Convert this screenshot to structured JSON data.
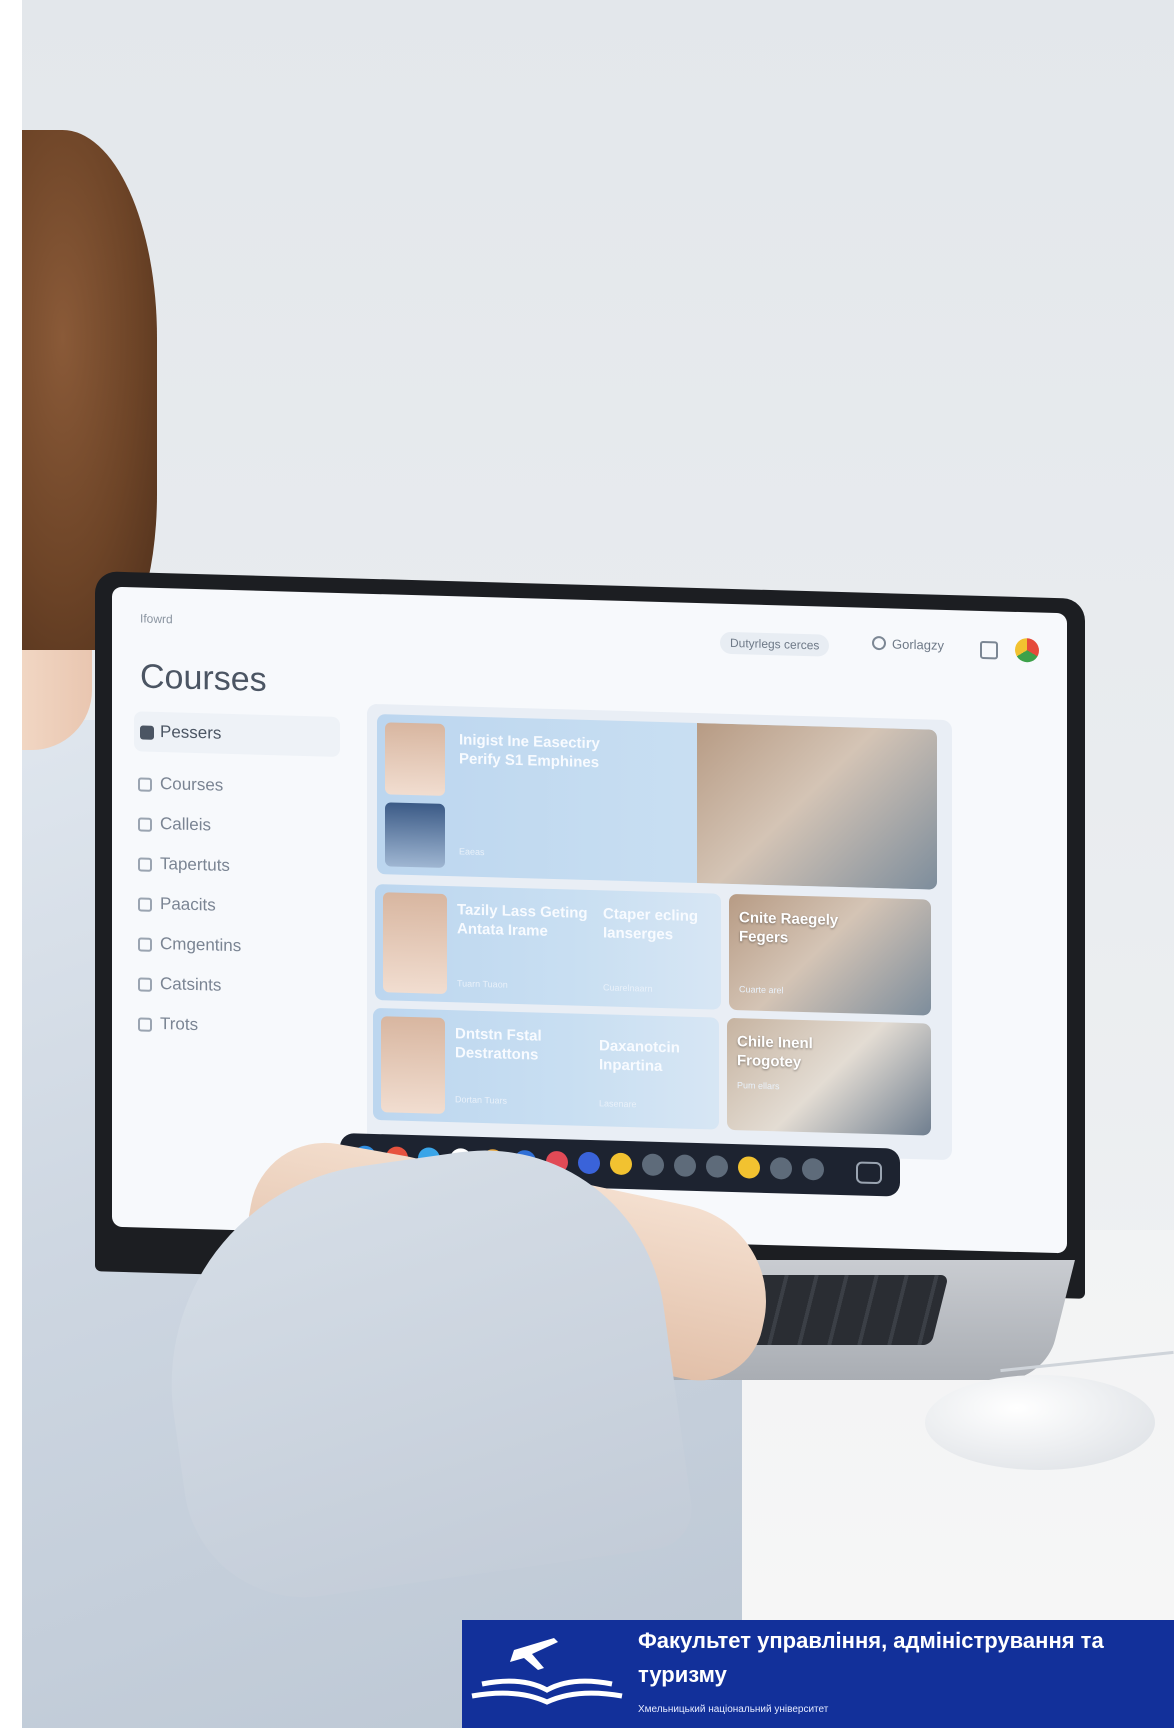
{
  "screen": {
    "menu_label": "Ifowrd",
    "header_pill": "Dutyrlegs cerces",
    "search_text": "Gorlagzy",
    "page_title": "Courses",
    "sidebar": [
      {
        "label": "Pessers",
        "active": true
      },
      {
        "label": "Courses",
        "active": false
      },
      {
        "label": "Calleis",
        "active": false
      },
      {
        "label": "Tapertuts",
        "active": false
      },
      {
        "label": "Paacits",
        "active": false
      },
      {
        "label": "Cmgentins",
        "active": false
      },
      {
        "label": "Catsints",
        "active": false
      },
      {
        "label": "Trots",
        "active": false
      }
    ],
    "cards": [
      {
        "title": "Inigist Ine Easectiry Perify S1 Emphines",
        "subtitle": "Eaeas"
      },
      {
        "title": "Tazily Lass Geting Antata Irame",
        "subtitle": "Tuarn Tuaon"
      },
      {
        "title": "Ctaper ecling Ianserges",
        "subtitle": "Cuarelnaarn"
      },
      {
        "title": "Cnite Raegely Fegers",
        "subtitle": "Cuarte arel"
      },
      {
        "title": "Dntstn Fstal Destrattons",
        "subtitle": "Dortan Tuars"
      },
      {
        "title": "Daxanotcin Inpartina",
        "subtitle": "Lasenare"
      },
      {
        "title": "Chile Inenl Frogotey",
        "subtitle": "Pum ellars"
      }
    ],
    "dock_colors": [
      "#2f8de0",
      "#e7533f",
      "#3aa5e8",
      "#ffffff",
      "#e5a43a",
      "#2f6fd6",
      "#e14a56",
      "#3a63d9",
      "#f2c230",
      "#5e6b7a",
      "#5e6b7a",
      "#5e6b7a",
      "#f2c230",
      "#5e6b7a",
      "#5e6b7a"
    ]
  },
  "banner": {
    "title_line1": "Факультет управління, адміністрування та",
    "title_line2": "туризму",
    "subtitle": "Хмельницький національний університет",
    "background": "#12309a",
    "logo_icon": "airplane-book-icon"
  }
}
